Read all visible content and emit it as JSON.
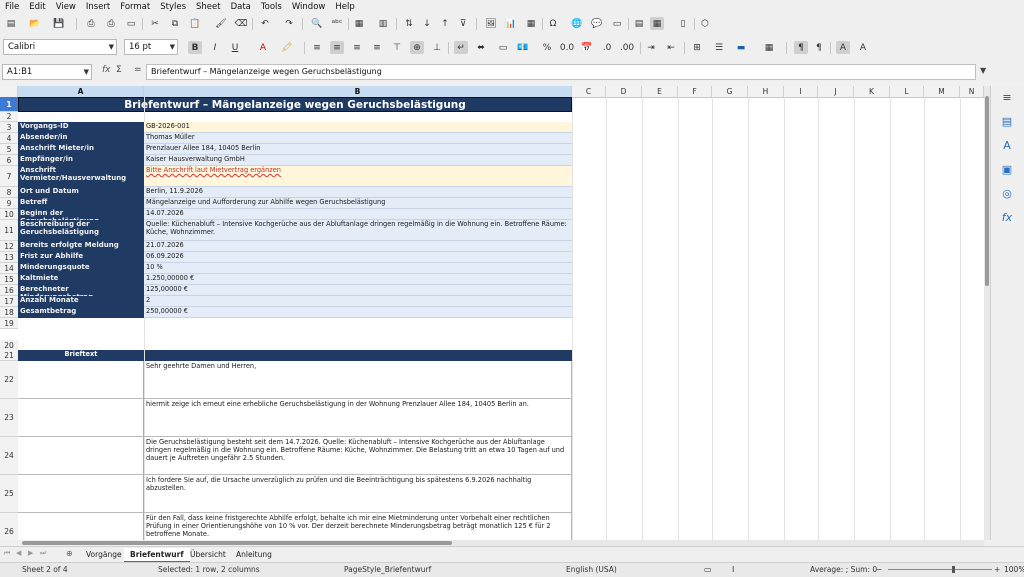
{
  "menu": [
    "File",
    "Edit",
    "View",
    "Insert",
    "Format",
    "Styles",
    "Sheet",
    "Data",
    "Tools",
    "Window",
    "Help"
  ],
  "font": {
    "name": "Calibri",
    "size": "16 pt"
  },
  "namebox": "A1:B1",
  "formula": {
    "fx": "fx",
    "sum": "Σ",
    "eq": "=",
    "content": "Briefentwurf – Mängelanzeige wegen Geruchsbelästigung"
  },
  "columns": [
    "A",
    "B",
    "C",
    "D",
    "E",
    "F",
    "G",
    "H",
    "I",
    "J",
    "K",
    "L",
    "M",
    "N"
  ],
  "title": "Briefentwurf – Mängelanzeige wegen Geruchsbelästigung",
  "rows": [
    {
      "n": "3",
      "label": "Vorgangs-ID",
      "value": "GB-2026-001"
    },
    {
      "n": "4",
      "label": "Absender/in",
      "value": "Thomas Müller"
    },
    {
      "n": "5",
      "label": "Anschrift Mieter/in",
      "value": "Prenzlauer Allee 184, 10405 Berlin"
    },
    {
      "n": "6",
      "label": "Empfänger/in",
      "value": "Kaiser Hausverwaltung GmbH"
    },
    {
      "n": "7",
      "label": "Anschrift Vermieter/Hausverwaltung",
      "value": "Bitte Anschrift laut Mietvertrag ergänzen"
    },
    {
      "n": "8",
      "label": "Ort und Datum",
      "value": "Berlin, 11.9.2026"
    },
    {
      "n": "9",
      "label": "Betreff",
      "value": "Mängelanzeige und Aufforderung zur Abhilfe wegen Geruchsbelästigung"
    },
    {
      "n": "10",
      "label": "Beginn der Geruchsbelästigung",
      "value": "14.07.2026"
    },
    {
      "n": "11",
      "label": "Beschreibung der Geruchsbelästigung",
      "value": "Quelle: Küchenabluft – Intensive Kochgerüche aus der Abluftanlage dringen regelmäßig in die Wohnung ein. Betroffene Räume: Küche, Wohnzimmer."
    },
    {
      "n": "12",
      "label": "Bereits erfolgte Meldung",
      "value": "21.07.2026"
    },
    {
      "n": "13",
      "label": "Frist zur Abhilfe",
      "value": "06.09.2026"
    },
    {
      "n": "14",
      "label": "Minderungsquote",
      "value": "10 %"
    },
    {
      "n": "15",
      "label": "Kaltmiete",
      "value": "1.250,00000 €"
    },
    {
      "n": "16",
      "label": "Berechneter Minderungsbetrag",
      "value": "125,00000 €"
    },
    {
      "n": "17",
      "label": "Anzahl Monate",
      "value": "2"
    },
    {
      "n": "18",
      "label": "Gesamtbetrag",
      "value": "250,00000 €"
    }
  ],
  "brieftext_header": "Brieftext",
  "letter": [
    {
      "n": "22",
      "text": "Sehr geehrte Damen und Herren,"
    },
    {
      "n": "23",
      "text": "hiermit zeige ich erneut eine erhebliche Geruchsbelästigung in der Wohnung Prenzlauer Allee 184, 10405 Berlin an."
    },
    {
      "n": "24",
      "text": "Die Geruchsbelästigung besteht seit dem 14.7.2026. Quelle: Küchenabluft – Intensive Kochgerüche aus der Abluftanlage dringen regelmäßig in die Wohnung ein. Betroffene Räume: Küche, Wohnzimmer. Die Belastung tritt an etwa 10 Tagen auf und dauert je Auftreten ungefähr 2.5 Stunden."
    },
    {
      "n": "25",
      "text": "Ich fordere Sie auf, die Ursache unverzüglich zu prüfen und die Beeinträchtigung bis spätestens 6.9.2026 nachhaltig abzustellen."
    },
    {
      "n": "26",
      "text": "Für den Fall, dass keine fristgerechte Abhilfe erfolgt, behalte ich mir eine Mietminderung unter Vorbehalt einer rechtlichen Prüfung in einer Orientierungshöhe von 10 % vor. Der derzeit berechnete Minderungsbetrag beträgt monatlich 125 € für 2 betroffene Monate."
    }
  ],
  "tabs": [
    "Vorgänge",
    "Briefentwurf",
    "Übersicht",
    "Anleitung"
  ],
  "status": {
    "sheet": "Sheet 2 of 4",
    "selected": "Selected: 1 row, 2 columns",
    "pagestyle": "PageStyle_Briefentwurf",
    "language": "English (USA)",
    "average": "Average: ; Sum: 0",
    "zoom": "100%"
  }
}
